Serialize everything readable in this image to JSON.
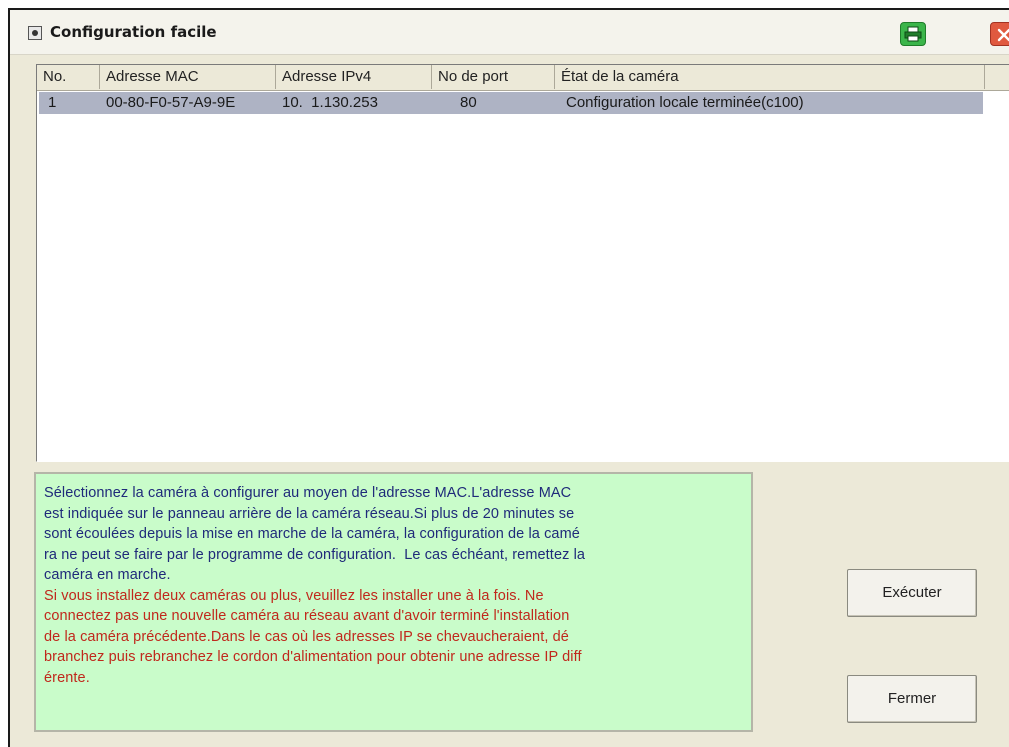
{
  "window": {
    "title": "Configuration facile"
  },
  "table": {
    "columns": [
      "No.",
      "Adresse MAC",
      "Adresse IPv4",
      "No de port",
      "État de la caméra"
    ],
    "rows": [
      {
        "no": "1",
        "mac": "00-80-F0-57-A9-9E",
        "ipv4": "10.  1.130.253",
        "port": "80",
        "state": "Configuration locale terminée(c100)"
      }
    ]
  },
  "info": {
    "lines_normal": [
      "Sélectionnez la caméra à configurer au moyen de l'adresse MAC.L'adresse MAC",
      "est indiquée sur le panneau arrière de la caméra réseau.Si plus de 20 minutes se",
      "sont écoulées depuis la mise en marche de la caméra, la configuration de la camé",
      "ra ne peut se faire par le programme de configuration.  Le cas échéant, remettez la",
      "caméra en marche."
    ],
    "lines_warning": [
      "Si vous installez deux caméras ou plus, veuillez les installer une à la fois. Ne",
      "connectez pas une nouvelle caméra au réseau avant d'avoir terminé l'installation",
      "de la caméra précédente.Dans le cas où les adresses IP se chevaucheraient, dé",
      "branchez puis rebranchez le cordon d'alimentation pour obtenir une adresse IP diff",
      "érente."
    ]
  },
  "buttons": {
    "execute": "Exécuter",
    "close": "Fermer"
  },
  "colors": {
    "selection": "#aeb3c4",
    "info_background": "#c9fcca",
    "warning_text": "#c0281c"
  },
  "icons": {
    "title": "camera-app-icon",
    "print": "printer-icon",
    "close": "close-x-icon"
  }
}
